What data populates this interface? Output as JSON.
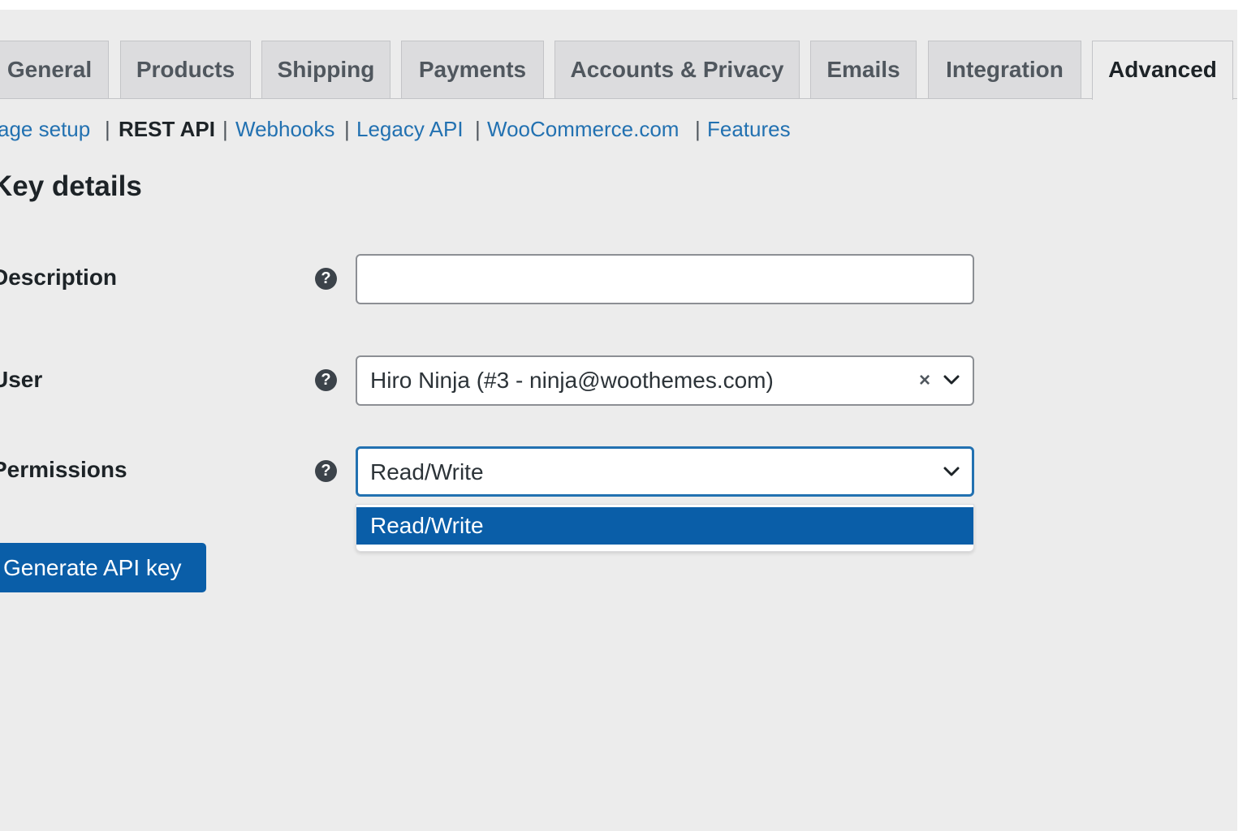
{
  "tabs": [
    {
      "label": "General"
    },
    {
      "label": "Products"
    },
    {
      "label": "Shipping"
    },
    {
      "label": "Payments"
    },
    {
      "label": "Accounts & Privacy"
    },
    {
      "label": "Emails"
    },
    {
      "label": "Integration"
    },
    {
      "label": "Advanced",
      "active": true
    }
  ],
  "subnav": {
    "items": [
      {
        "label": "age setup"
      },
      {
        "label": "REST API",
        "current": true
      },
      {
        "label": "Webhooks"
      },
      {
        "label": "Legacy API"
      },
      {
        "label": "WooCommerce.com"
      },
      {
        "label": "Features"
      }
    ],
    "separator": "|"
  },
  "section": {
    "title": "Key details"
  },
  "form": {
    "description": {
      "label": "Description",
      "value": ""
    },
    "user": {
      "label": "User",
      "value": "Hiro Ninja (#3 - ninja@woothemes.com)",
      "clear_symbol": "×"
    },
    "permissions": {
      "label": "Permissions",
      "value": "Read/Write",
      "options": [
        "Read/Write"
      ],
      "highlighted_option": "Read/Write"
    },
    "help_symbol": "?",
    "submit_label": "Generate API key"
  },
  "colors": {
    "link": "#2271b1",
    "primary": "#0a5ea8",
    "background": "#ececec",
    "tab_inactive": "#dcdcde"
  }
}
